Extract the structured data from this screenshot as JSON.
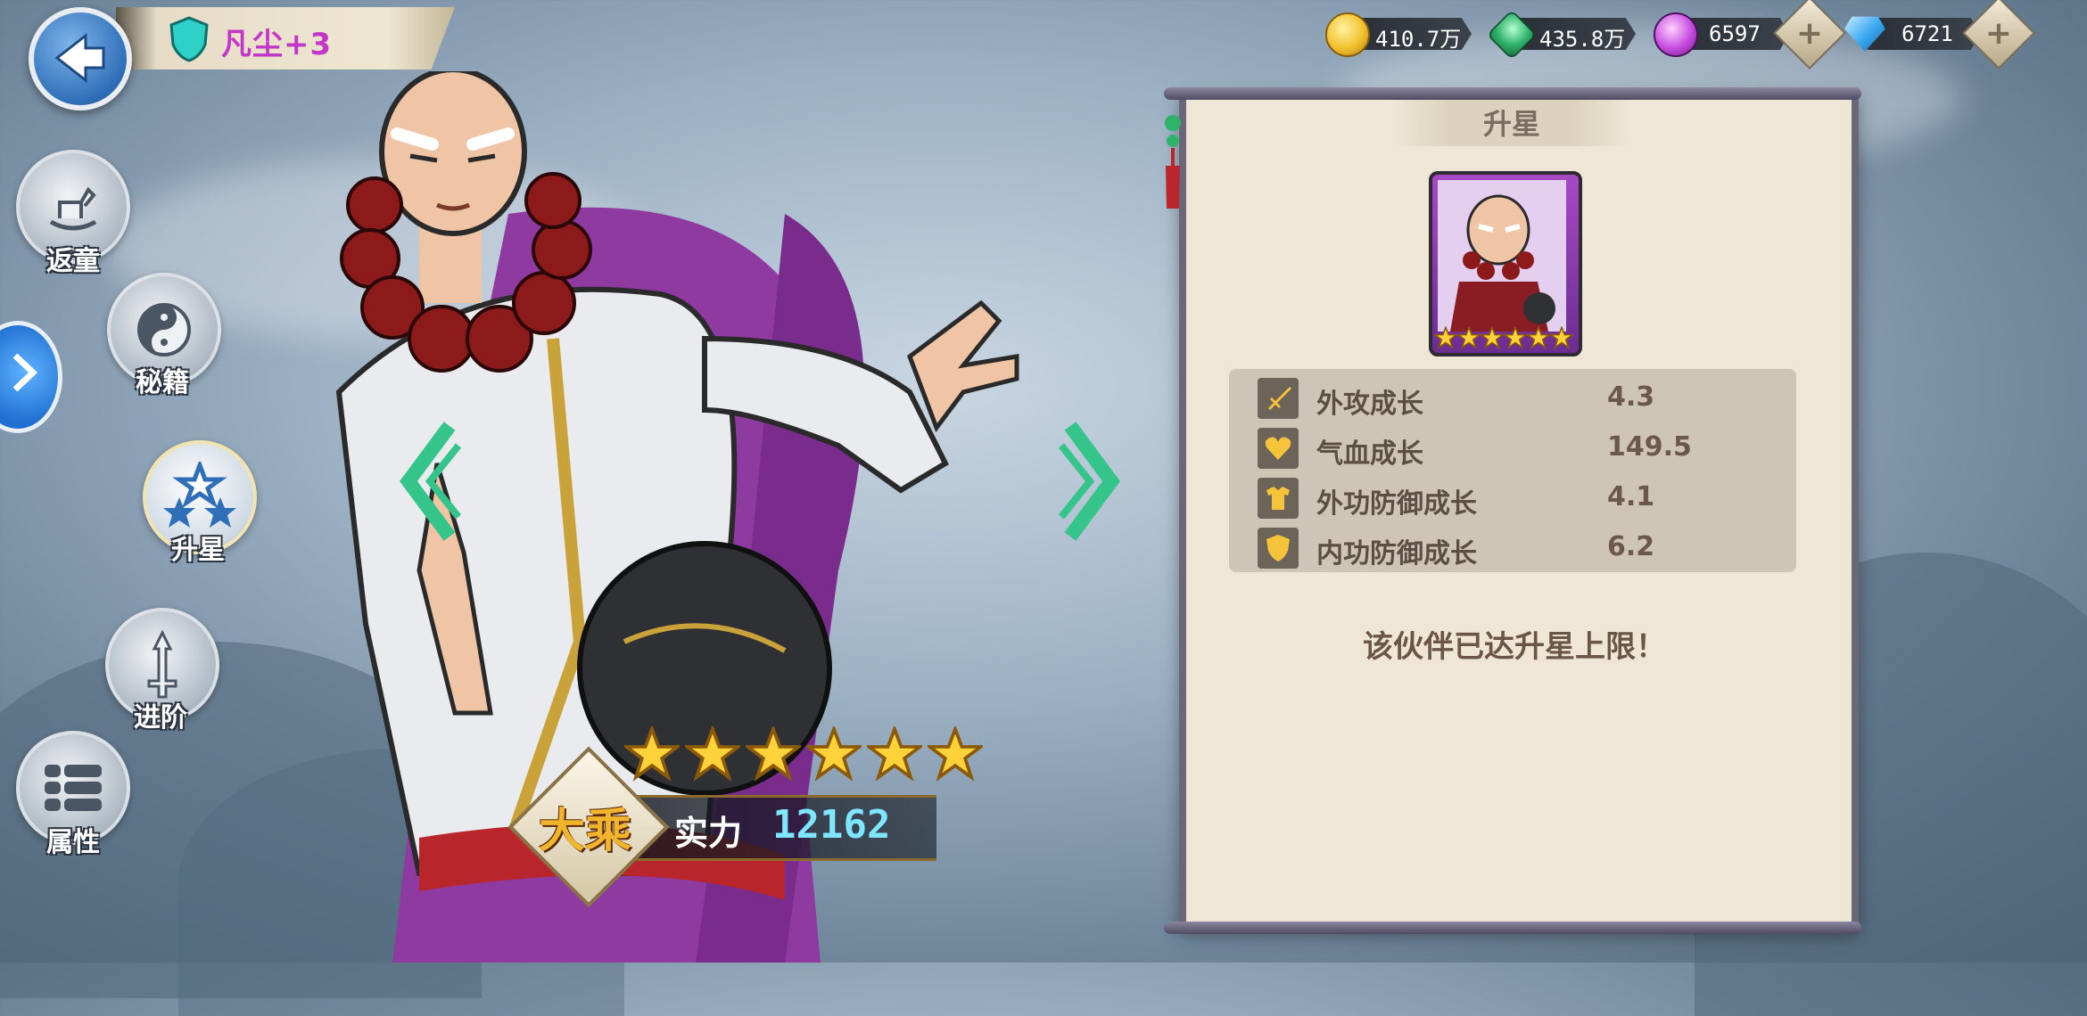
{
  "header": {
    "hero_name": "凡尘+3"
  },
  "currencies": [
    {
      "name": "gold",
      "value": "410.7万",
      "icon": "gold-coin-icon",
      "color": "#f2c12e"
    },
    {
      "name": "jade",
      "value": "435.8万",
      "icon": "green-gem-icon",
      "color": "#2fb36a"
    },
    {
      "name": "spirit",
      "value": "6597",
      "icon": "purple-orb-icon",
      "color": "#c64be0"
    },
    {
      "name": "diamond",
      "value": "6721",
      "icon": "blue-diamond-icon",
      "color": "#3aa8f0"
    }
  ],
  "menu": {
    "items": [
      {
        "label": "返童",
        "icon": "rocking-horse-icon"
      },
      {
        "label": "秘籍",
        "icon": "yin-yang-icon"
      },
      {
        "label": "升星",
        "icon": "three-stars-icon",
        "active": true
      },
      {
        "label": "进阶",
        "icon": "sword-up-icon"
      },
      {
        "label": "属性",
        "icon": "attributes-list-icon"
      }
    ]
  },
  "character": {
    "stars": 6,
    "rank": "大乘",
    "power_label": "实力",
    "power_value": "12162"
  },
  "panel": {
    "title": "升星",
    "portrait_stars": 6,
    "stats": [
      {
        "name": "外攻成长",
        "value": "4.3",
        "icon": "sword-icon"
      },
      {
        "name": "气血成长",
        "value": "149.5",
        "icon": "heart-icon"
      },
      {
        "name": "外功防御成长",
        "value": "4.1",
        "icon": "armor-icon"
      },
      {
        "name": "内功防御成长",
        "value": "6.2",
        "icon": "shield-icon"
      }
    ],
    "max_message": "该伙伴已达升星上限！"
  },
  "colors": {
    "accent_gold": "#f2c12e",
    "power_cyan": "#7fe6ff",
    "name_purple": "#c236c8",
    "arrow_green": "#35c48a"
  }
}
